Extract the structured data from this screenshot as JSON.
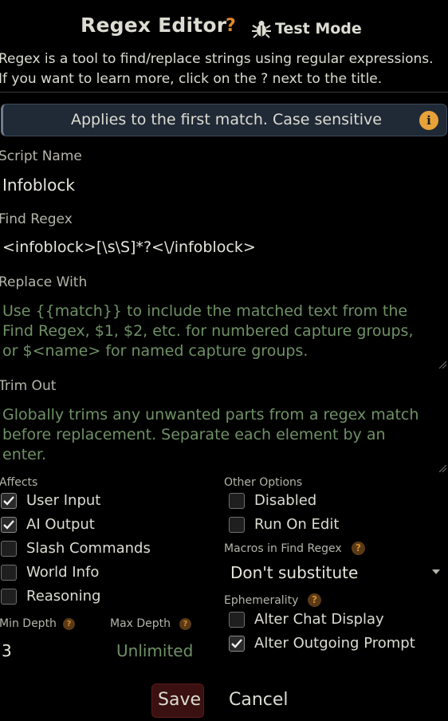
{
  "header": {
    "title": "Regex Editor",
    "help_mark": "?",
    "test_mode_label": "Test Mode",
    "test_mode_icon": "bug-icon"
  },
  "description": {
    "line1": "Regex is a tool to find/replace strings using regular expressions.",
    "line2": "If you want to learn more, click on the ? next to the title."
  },
  "notice": {
    "text": "Applies to the first match. Case sensitive",
    "icon": "info-icon",
    "icon_color": "#e8a23a"
  },
  "script_name": {
    "label": "Script Name",
    "value": "Infoblock"
  },
  "find_regex": {
    "label": "Find Regex",
    "value": "<infoblock>[\\s\\S]*?<\\/infoblock>"
  },
  "replace_with": {
    "label": "Replace With",
    "placeholder_lines": [
      "Use {{match}} to include the matched text from the",
      "Find Regex, $1, $2, etc. for numbered capture groups,",
      "or $<name> for named capture groups."
    ]
  },
  "trim_out": {
    "label": "Trim Out",
    "placeholder_lines": [
      "Globally trims any unwanted parts from a regex match",
      "before replacement. Separate each element by an",
      "enter."
    ]
  },
  "affects": {
    "label": "Affects",
    "items": [
      {
        "label": "User Input",
        "checked": true
      },
      {
        "label": "AI Output",
        "checked": true
      },
      {
        "label": "Slash Commands",
        "checked": false
      },
      {
        "label": "World Info",
        "checked": false
      },
      {
        "label": "Reasoning",
        "checked": false
      }
    ]
  },
  "depth": {
    "min_label": "Min Depth",
    "min_value": "3",
    "max_label": "Max Depth",
    "max_placeholder": "Unlimited"
  },
  "other_options": {
    "label": "Other Options",
    "items": [
      {
        "label": "Disabled",
        "checked": false
      },
      {
        "label": "Run On Edit",
        "checked": false
      }
    ]
  },
  "macros": {
    "label": "Macros in Find Regex",
    "selected": "Don't substitute"
  },
  "ephemerality": {
    "label": "Ephemerality",
    "items": [
      {
        "label": "Alter Chat Display",
        "checked": false
      },
      {
        "label": "Alter Outgoing Prompt",
        "checked": true
      }
    ]
  },
  "footer": {
    "save_label": "Save",
    "cancel_label": "Cancel",
    "save_color": "#3a1010"
  },
  "colors": {
    "accent_orange": "#e18a24",
    "placeholder_green": "#6f9166",
    "notice_bg": "#202a36"
  }
}
